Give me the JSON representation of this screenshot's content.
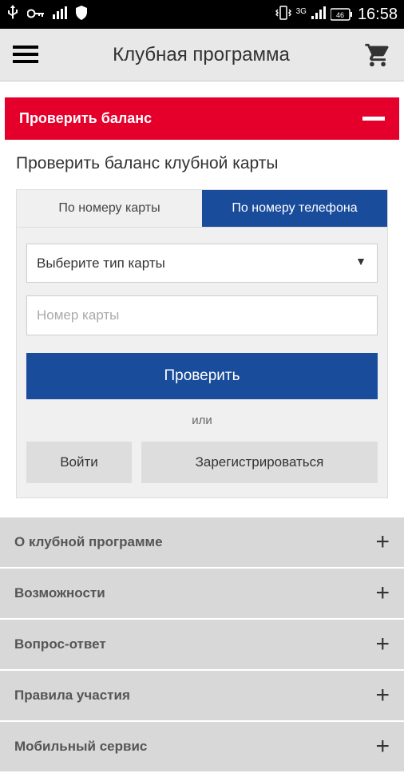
{
  "status": {
    "time": "16:58",
    "battery": "46"
  },
  "header": {
    "title": "Клубная программа"
  },
  "accordion_main": {
    "title": "Проверить баланс"
  },
  "section": {
    "title": "Проверить баланс клубной карты"
  },
  "tabs": {
    "card": "По номеру карты",
    "phone": "По номеру телефона"
  },
  "form": {
    "select_placeholder": "Выберите тип карты",
    "input_placeholder": "Номер карты",
    "submit": "Проверить",
    "or": "или",
    "login": "Войти",
    "register": "Зарегистрироваться"
  },
  "accordion_items": [
    {
      "label": "О клубной программе"
    },
    {
      "label": "Возможности"
    },
    {
      "label": "Вопрос-ответ"
    },
    {
      "label": "Правила участия"
    },
    {
      "label": "Мобильный сервис"
    }
  ]
}
